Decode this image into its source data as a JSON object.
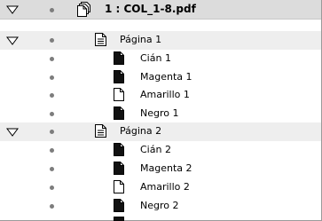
{
  "document": {
    "label": "1 : COL_1-8.pdf",
    "expanded": true
  },
  "pages": [
    {
      "label": "Página 1",
      "expanded": true,
      "plates": [
        {
          "label": "Cián 1",
          "type": "filled"
        },
        {
          "label": "Magenta 1",
          "type": "filled"
        },
        {
          "label": "Amarillo 1",
          "type": "empty"
        },
        {
          "label": "Negro 1",
          "type": "filled"
        }
      ]
    },
    {
      "label": "Página 2",
      "expanded": true,
      "plates": [
        {
          "label": "Cián 2",
          "type": "filled"
        },
        {
          "label": "Magenta 2",
          "type": "filled"
        },
        {
          "label": "Amarillo 2",
          "type": "empty"
        },
        {
          "label": "Negro 2",
          "type": "filled"
        }
      ]
    }
  ]
}
